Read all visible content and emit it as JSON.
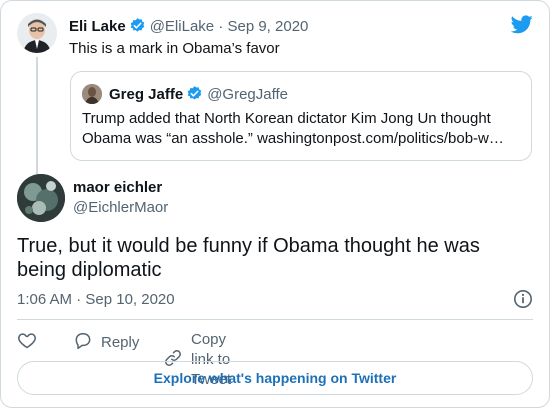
{
  "parent_tweet": {
    "author_name": "Eli Lake",
    "handle": "@EliLake",
    "separator": "·",
    "date": "Sep 9, 2020",
    "text": "This is a mark in Obama’s favor"
  },
  "quoted_tweet": {
    "author_name": "Greg Jaffe",
    "handle": "@GregJaffe",
    "text": "Trump added that North Korean dictator Kim Jong Un thought Obama was “an asshole.” washingtonpost.com/politics/bob-w…"
  },
  "main_tweet": {
    "author_name": "maor eichler",
    "handle": "@EichlerMaor",
    "text": "True, but it would be funny if Obama thought he was being diplomatic",
    "timestamp": "1:06 AM · Sep 10, 2020"
  },
  "actions": {
    "reply_label": "Reply",
    "copy_link_label": "Copy link to Tweet"
  },
  "explore_label": "Explore what's happening on Twitter",
  "icons": {
    "verified": "verified-badge-icon",
    "twitter": "twitter-bird-icon",
    "info": "info-icon",
    "like": "heart-icon",
    "reply": "speech-bubble-icon",
    "link": "link-icon"
  },
  "colors": {
    "brand_blue": "#1d9bf0",
    "link_blue": "#1d70b8",
    "secondary_text": "#536471",
    "border": "#cfd9de"
  }
}
